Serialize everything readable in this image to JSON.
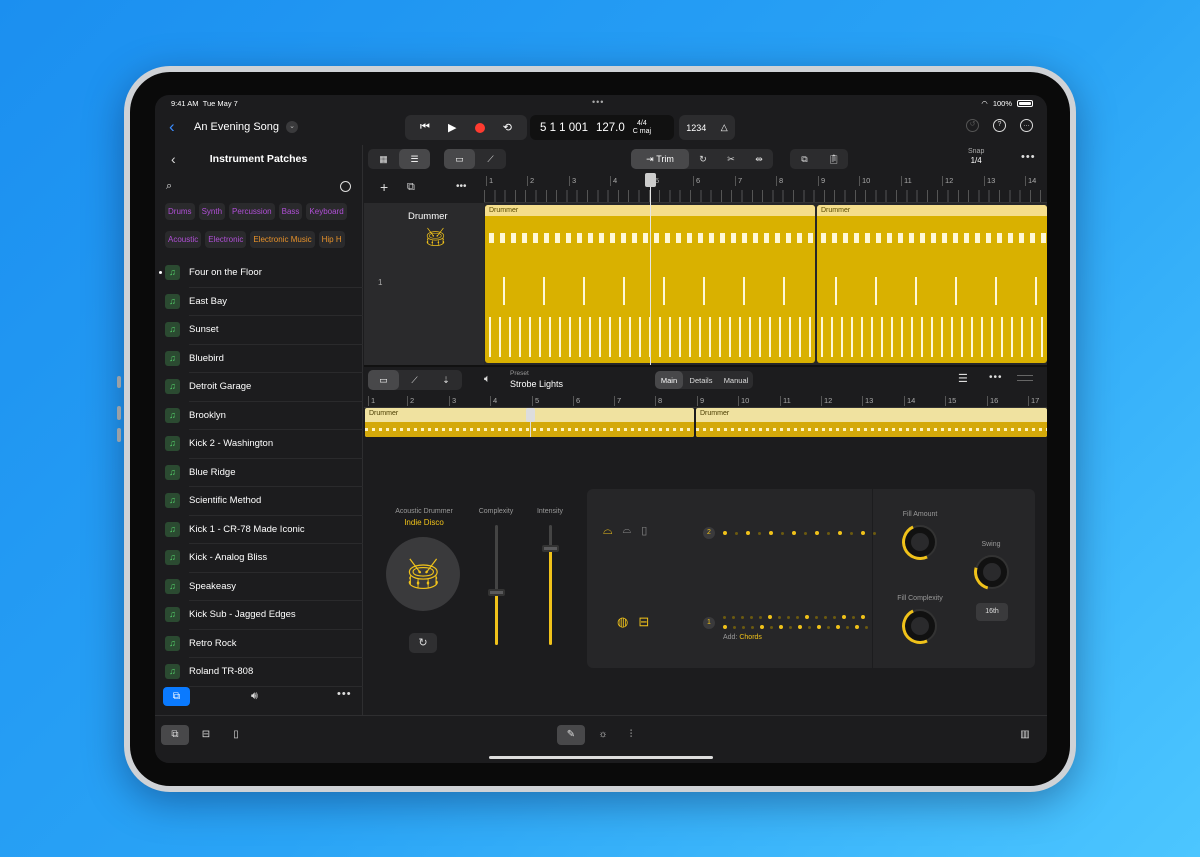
{
  "status": {
    "time": "9:41 AM",
    "date": "Tue May 7",
    "battery": "100%"
  },
  "header": {
    "song_title": "An Evening Song",
    "position": "5 1 1 001",
    "tempo": "127.0",
    "time_signature": "4/4",
    "key": "C maj",
    "count_in": "1234"
  },
  "sidebar": {
    "title": "Instrument Patches",
    "tags_row1": [
      "Drums",
      "Synth",
      "Percussion",
      "Bass",
      "Keyboard"
    ],
    "tags_row2": [
      "Acoustic",
      "Electronic",
      "Electronic Music",
      "Hip H"
    ],
    "patches": [
      "Four on the Floor",
      "East Bay",
      "Sunset",
      "Bluebird",
      "Detroit Garage",
      "Brooklyn",
      "Kick 2 - Washington",
      "Blue Ridge",
      "Scientific Method",
      "Kick 1 - CR-78 Made Iconic",
      "Kick - Analog Bliss",
      "Speakeasy",
      "Kick Sub - Jagged Edges",
      "Retro Rock",
      "Roland TR-808"
    ],
    "selected_patch": "Four on the Floor"
  },
  "tracks": {
    "trim_label": "Trim",
    "snap_label": "Snap",
    "snap_value": "1/4",
    "track_name": "Drummer",
    "track_number": "1",
    "region_label": "Drummer",
    "ruler": [
      "1",
      "2",
      "3",
      "4",
      "5",
      "6",
      "7",
      "8",
      "9",
      "10",
      "11",
      "12",
      "13",
      "14"
    ]
  },
  "editor": {
    "preset_label": "Preset",
    "preset_value": "Strobe Lights",
    "tabs": [
      "Main",
      "Details",
      "Manual"
    ],
    "active_tab": "Main",
    "ruler": [
      "1",
      "2",
      "3",
      "4",
      "5",
      "6",
      "7",
      "8",
      "9",
      "10",
      "11",
      "12",
      "13",
      "14",
      "15",
      "16",
      "17"
    ],
    "region_label": "Drummer",
    "drummer_label": "Acoustic Drummer",
    "drummer_name": "Indie Disco",
    "complexity_label": "Complexity",
    "intensity_label": "Intensity",
    "complexity_value": 0.43,
    "intensity_value": 0.8,
    "pattern_top_badge": "2",
    "pattern_bottom_badge": "1",
    "add_label": "Add:",
    "add_value": "Chords",
    "fill_amount_label": "Fill Amount",
    "fill_complexity_label": "Fill Complexity",
    "swing_label": "Swing",
    "swing_button": "16th"
  },
  "icons": {
    "back": "chevron-left-icon",
    "play": "play-icon",
    "record": "record-icon",
    "loop": "loop-icon",
    "metronome": "metronome-icon"
  }
}
